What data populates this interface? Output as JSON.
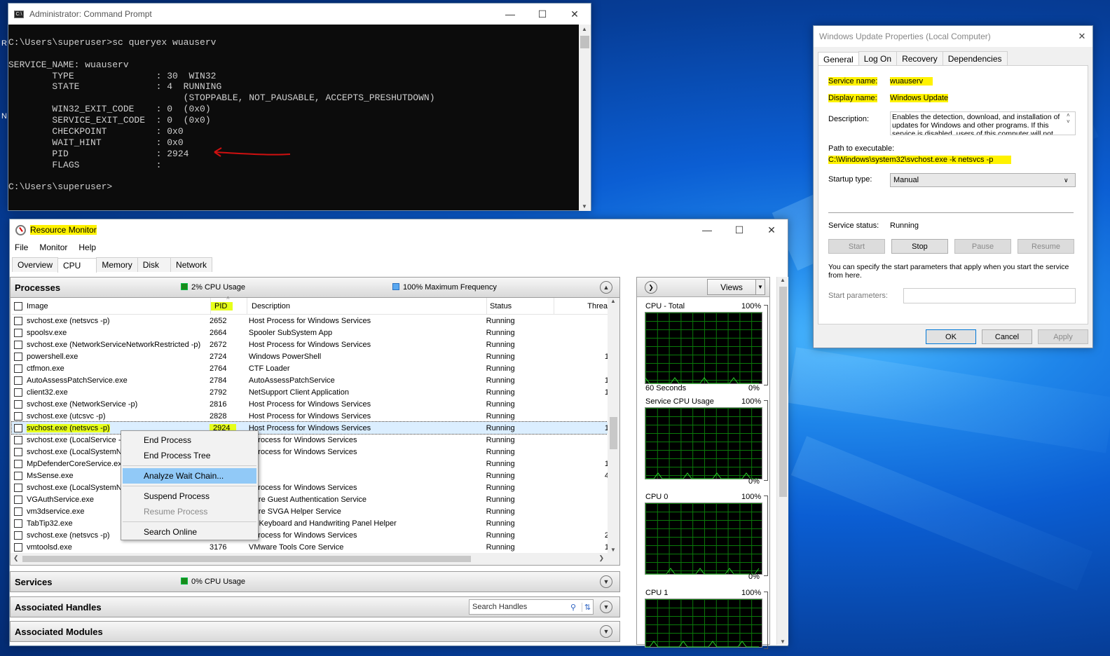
{
  "cmd": {
    "title": "Administrator: Command Prompt",
    "lines": [
      "",
      "C:\\Users\\superuser>sc queryex wuauserv",
      "",
      "SERVICE_NAME: wuauserv",
      "        TYPE               : 30  WIN32",
      "        STATE              : 4  RUNNING",
      "                                (STOPPABLE, NOT_PAUSABLE, ACCEPTS_PRESHUTDOWN)",
      "        WIN32_EXIT_CODE    : 0  (0x0)",
      "        SERVICE_EXIT_CODE  : 0  (0x0)",
      "        CHECKPOINT         : 0x0",
      "        WAIT_HINT          : 0x0",
      "        PID                : 2924",
      "        FLAGS              :",
      "",
      "C:\\Users\\superuser>"
    ]
  },
  "resmon": {
    "title": "Resource Monitor",
    "menu": [
      "File",
      "Monitor",
      "Help"
    ],
    "tabs": [
      "Overview",
      "CPU",
      "Memory",
      "Disk",
      "Network"
    ],
    "processes": {
      "label": "Processes",
      "cpu": "2% CPU Usage",
      "freq": "100% Maximum Frequency",
      "cols": {
        "image": "Image",
        "pid": "PID",
        "desc": "Description",
        "status": "Status",
        "threads": "Threa"
      },
      "rows": [
        {
          "image": "svchost.exe (netsvcs -p)",
          "pid": "2652",
          "desc": "Host Process for Windows Services",
          "status": "Running",
          "thr": ""
        },
        {
          "image": "spoolsv.exe",
          "pid": "2664",
          "desc": "Spooler SubSystem App",
          "status": "Running",
          "thr": ""
        },
        {
          "image": "svchost.exe (NetworkServiceNetworkRestricted -p)",
          "pid": "2672",
          "desc": "Host Process for Windows Services",
          "status": "Running",
          "thr": ""
        },
        {
          "image": "powershell.exe",
          "pid": "2724",
          "desc": "Windows PowerShell",
          "status": "Running",
          "thr": "1"
        },
        {
          "image": "ctfmon.exe",
          "pid": "2764",
          "desc": "CTF Loader",
          "status": "Running",
          "thr": ""
        },
        {
          "image": "AutoAssessPatchService.exe",
          "pid": "2784",
          "desc": "AutoAssessPatchService",
          "status": "Running",
          "thr": "1"
        },
        {
          "image": "client32.exe",
          "pid": "2792",
          "desc": "NetSupport Client Application",
          "status": "Running",
          "thr": "1"
        },
        {
          "image": "svchost.exe (NetworkService -p)",
          "pid": "2816",
          "desc": "Host Process for Windows Services",
          "status": "Running",
          "thr": ""
        },
        {
          "image": "svchost.exe (utcsvc -p)",
          "pid": "2828",
          "desc": "Host Process for Windows Services",
          "status": "Running",
          "thr": ""
        },
        {
          "image": "svchost.exe (netsvcs -p)",
          "pid": "2924",
          "desc": "Host Process for Windows Services",
          "status": "Running",
          "thr": "1"
        },
        {
          "image": "svchost.exe (LocalService -p",
          "pid": "",
          "desc": "t Process for Windows Services",
          "status": "Running",
          "thr": ""
        },
        {
          "image": "svchost.exe (LocalSystemNe",
          "pid": "",
          "desc": "t Process for Windows Services",
          "status": "Running",
          "thr": ""
        },
        {
          "image": "MpDefenderCoreService.ex",
          "pid": "",
          "desc": "",
          "status": "Running",
          "thr": "1"
        },
        {
          "image": "MsSense.exe",
          "pid": "",
          "desc": "",
          "status": "Running",
          "thr": "4"
        },
        {
          "image": "svchost.exe (LocalSystemNe",
          "pid": "",
          "desc": "t Process for Windows Services",
          "status": "Running",
          "thr": ""
        },
        {
          "image": "VGAuthService.exe",
          "pid": "",
          "desc": "ware Guest Authentication Service",
          "status": "Running",
          "thr": ""
        },
        {
          "image": "vm3dservice.exe",
          "pid": "",
          "desc": "ware SVGA Helper Service",
          "status": "Running",
          "thr": ""
        },
        {
          "image": "TabTip32.exe",
          "pid": "",
          "desc": "ch Keyboard and Handwriting Panel Helper",
          "status": "Running",
          "thr": ""
        },
        {
          "image": "svchost.exe (netsvcs -p)",
          "pid": "",
          "desc": "t Process for Windows Services",
          "status": "Running",
          "thr": "2"
        },
        {
          "image": "vmtoolsd.exe",
          "pid": "3176",
          "desc": "VMware Tools Core Service",
          "status": "Running",
          "thr": "1"
        }
      ]
    },
    "services": {
      "label": "Services",
      "cpu": "0% CPU Usage"
    },
    "handles": {
      "label": "Associated Handles",
      "placeholder": "Search Handles"
    },
    "modules": {
      "label": "Associated Modules"
    },
    "views": "Views",
    "graphs": [
      {
        "title": "CPU - Total",
        "max": "100%",
        "foot": "60 Seconds",
        "min": "0%"
      },
      {
        "title": "Service CPU Usage",
        "max": "100%",
        "foot": "",
        "min": "0%"
      },
      {
        "title": "CPU 0",
        "max": "100%",
        "foot": "",
        "min": "0%"
      },
      {
        "title": "CPU 1",
        "max": "100%",
        "foot": "",
        "min": ""
      }
    ]
  },
  "context": {
    "items": [
      "End Process",
      "End Process Tree",
      "Analyze Wait Chain...",
      "Suspend Process",
      "Resume Process",
      "Search Online"
    ]
  },
  "props": {
    "title": "Windows Update Properties (Local Computer)",
    "tabs": [
      "General",
      "Log On",
      "Recovery",
      "Dependencies"
    ],
    "svc_name_label": "Service name:",
    "svc_name": "wuauserv",
    "disp_label": "Display name:",
    "disp": "Windows Update",
    "desc_label": "Description:",
    "desc": "Enables the detection, download, and installation of updates for Windows and other programs. If this service is disabled, users of this computer will not be",
    "path_label": "Path to executable:",
    "path": "C:\\Windows\\system32\\svchost.exe -k netsvcs -p",
    "startup_label": "Startup type:",
    "startup": "Manual",
    "status_label": "Service status:",
    "status": "Running",
    "btn_start": "Start",
    "btn_stop": "Stop",
    "btn_pause": "Pause",
    "btn_resume": "Resume",
    "note": "You can specify the start parameters that apply when you start the service from here.",
    "params_label": "Start parameters:",
    "ok": "OK",
    "cancel": "Cancel",
    "apply": "Apply"
  },
  "desktop": {
    "frag1": "R",
    "frag2": "N"
  }
}
